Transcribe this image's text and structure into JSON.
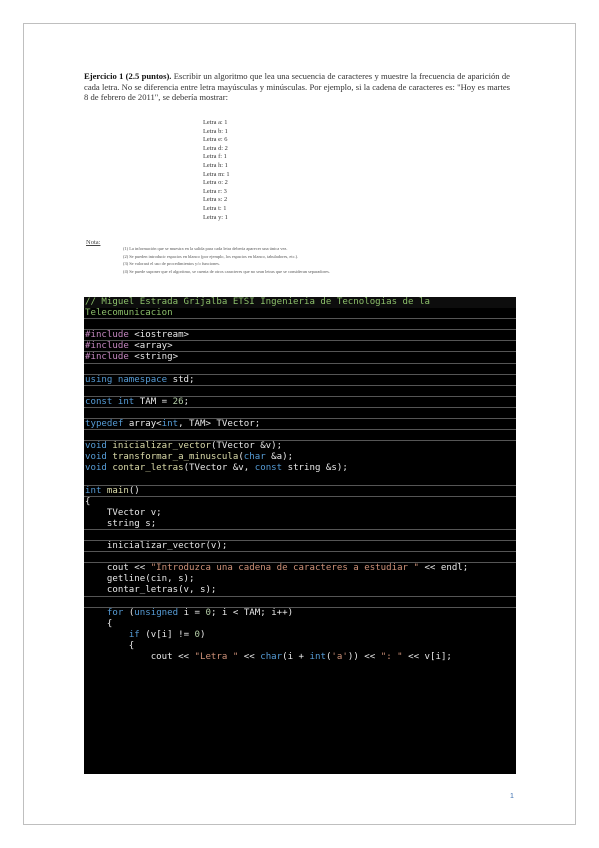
{
  "exercise": {
    "title": "Ejercicio 1 (2.5 puntos).",
    "text": "Escribir un algoritmo que lea una secuencia de caracteres y muestre la frecuencia de aparición de cada letra. No se diferencia entre letra mayúsculas y minúsculas. Por ejemplo, si la cadena de caracteres es: \"Hoy es martes 8 de febrero de 2011\", se debería mostrar:"
  },
  "letters": [
    "Letra a: 1",
    "Letra b: 1",
    "Letra e: 6",
    "Letra d: 2",
    "Letra f: 1",
    "Letra h: 1",
    "Letra m: 1",
    "Letra o: 2",
    "Letra r: 3",
    "Letra s: 2",
    "Letra t: 1",
    "Letra y: 1"
  ],
  "notes": {
    "label": "Nota:",
    "items": [
      "(1) La información que se muestra en la salida para cada letra debería aparecer una única vez.",
      "(2) Se pueden introducir espacios en blanco (por ejemplo, los espacios en blanco, tabuladores, etc.).",
      "(3) Se valorará el uso de procedimientos y/o funciones.",
      "(4) Se puede suponer que el algoritmo, se cuenta de otros caracteres que no sean letras que se consideran separadores."
    ]
  },
  "code": {
    "lines": [
      [
        [
          "comment",
          "// Miguel Estrada Grijalba ETSI Ingenieria de Tecnologias de la"
        ]
      ],
      [
        [
          "comment",
          "Telecomunicacion"
        ]
      ],
      [],
      [
        [
          "pre",
          "#include "
        ],
        [
          "plain",
          "<iostream>"
        ]
      ],
      [
        [
          "pre",
          "#include "
        ],
        [
          "plain",
          "<array>"
        ]
      ],
      [
        [
          "pre",
          "#include "
        ],
        [
          "plain",
          "<string>"
        ]
      ],
      [],
      [
        [
          "kw",
          "using namespace "
        ],
        [
          "plain",
          "std;"
        ]
      ],
      [],
      [
        [
          "kw",
          "const int "
        ],
        [
          "plain",
          "TAM = "
        ],
        [
          "num",
          "26"
        ],
        [
          "plain",
          ";"
        ]
      ],
      [],
      [
        [
          "kw",
          "typedef "
        ],
        [
          "plain",
          "array<"
        ],
        [
          "kw",
          "int"
        ],
        [
          "plain",
          ", TAM> TVector;"
        ]
      ],
      [],
      [
        [
          "kw",
          "void "
        ],
        [
          "fn",
          "inicializar_vector"
        ],
        [
          "plain",
          "(TVector &v);"
        ]
      ],
      [
        [
          "kw",
          "void "
        ],
        [
          "fn",
          "transformar_a_minuscula"
        ],
        [
          "plain",
          "("
        ],
        [
          "kw",
          "char"
        ],
        [
          "plain",
          " &a);"
        ]
      ],
      [
        [
          "kw",
          "void "
        ],
        [
          "fn",
          "contar_letras"
        ],
        [
          "plain",
          "(TVector &v, "
        ],
        [
          "kw",
          "const "
        ],
        [
          "plain",
          "string &s);"
        ]
      ],
      [],
      [
        [
          "kw",
          "int "
        ],
        [
          "fn",
          "main"
        ],
        [
          "plain",
          "()"
        ]
      ],
      [
        [
          "plain",
          "{"
        ]
      ],
      [
        [
          "plain",
          "    TVector v;"
        ]
      ],
      [
        [
          "plain",
          "    string s;"
        ]
      ],
      [],
      [
        [
          "plain",
          "    inicializar_vector(v);"
        ]
      ],
      [],
      [
        [
          "plain",
          "    cout << "
        ],
        [
          "str",
          "\"Introduzca una cadena de caracteres a estudiar \""
        ],
        [
          "plain",
          " << endl;"
        ]
      ],
      [
        [
          "plain",
          "    getline(cin, s);"
        ]
      ],
      [
        [
          "plain",
          "    contar_letras(v, s);"
        ]
      ],
      [],
      [
        [
          "plain",
          "    "
        ],
        [
          "kw",
          "for"
        ],
        [
          "plain",
          " ("
        ],
        [
          "kw",
          "unsigned"
        ],
        [
          "plain",
          " i = "
        ],
        [
          "num",
          "0"
        ],
        [
          "plain",
          "; i < TAM; i++)"
        ]
      ],
      [
        [
          "plain",
          "    {"
        ]
      ],
      [
        [
          "plain",
          "        "
        ],
        [
          "kw",
          "if"
        ],
        [
          "plain",
          " (v[i] != "
        ],
        [
          "num",
          "0"
        ],
        [
          "plain",
          ")"
        ]
      ],
      [
        [
          "plain",
          "        {"
        ]
      ],
      [
        [
          "plain",
          "            cout << "
        ],
        [
          "str",
          "\"Letra \""
        ],
        [
          "plain",
          " << "
        ],
        [
          "kw",
          "char"
        ],
        [
          "plain",
          "(i + "
        ],
        [
          "kw",
          "int"
        ],
        [
          "plain",
          "("
        ],
        [
          "str",
          "'a'"
        ],
        [
          "plain",
          ")) << "
        ],
        [
          "str",
          "\": \""
        ],
        [
          "plain",
          " << v[i];"
        ]
      ]
    ]
  },
  "page_number": "1"
}
